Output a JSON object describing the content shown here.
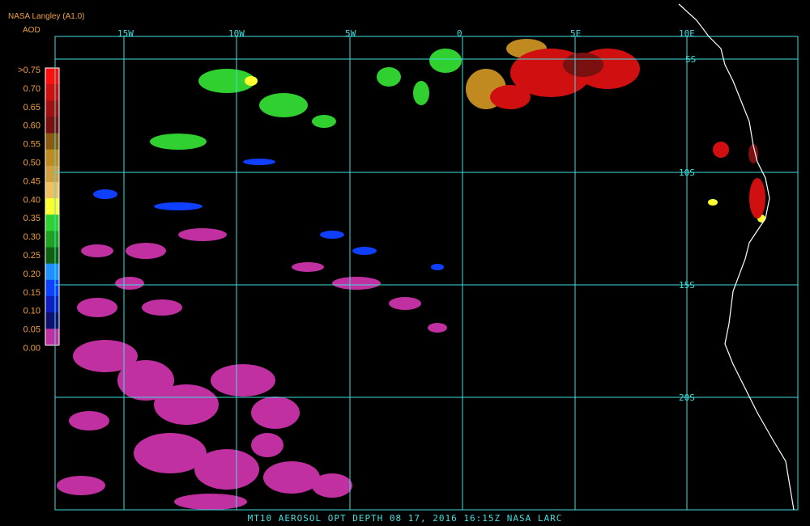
{
  "header": {
    "source": "NASA Langley (A1.0)",
    "variable": "AOD"
  },
  "legend": {
    "labels": [
      ">0.75",
      "0.70",
      "0.65",
      "0.60",
      "0.55",
      "0.50",
      "0.45",
      "0.40",
      "0.35",
      "0.30",
      "0.25",
      "0.20",
      "0.15",
      "0.10",
      "0.05",
      "0.00"
    ],
    "colors": [
      "#ff1010",
      "#d01010",
      "#a01010",
      "#7a1010",
      "#8a5a10",
      "#c08a20",
      "#d0a040",
      "#f0c060",
      "#ffff30",
      "#30d030",
      "#20a020",
      "#106010",
      "#2090ff",
      "#1040ff",
      "#1020c0",
      "#101070",
      "#c030a0"
    ]
  },
  "axes": {
    "lon_labels": [
      "15W",
      "10W",
      "5W",
      "0",
      "5E",
      "10E"
    ],
    "lat_labels": [
      "5S",
      "10S",
      "15S",
      "20S"
    ]
  },
  "caption": "MT10  AEROSOL OPT DEPTH   08 17, 2016 16:15Z   NASA LARC"
}
